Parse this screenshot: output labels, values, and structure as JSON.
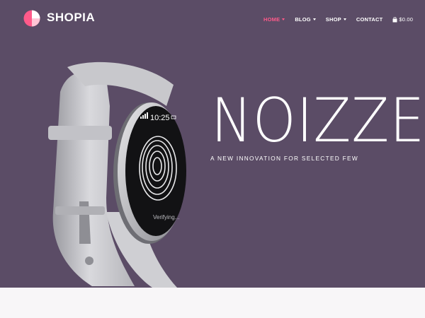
{
  "header": {
    "brand": "SHOPIA",
    "nav": [
      {
        "label": "HOME",
        "dropdown": true,
        "active": true
      },
      {
        "label": "BLOG",
        "dropdown": true,
        "active": false
      },
      {
        "label": "SHOP",
        "dropdown": true,
        "active": false
      },
      {
        "label": "CONTACT",
        "dropdown": false,
        "active": false
      }
    ],
    "cart_total": "$0.00"
  },
  "hero": {
    "title": "NOIZZE",
    "tagline": "A NEW INNOVATION FOR SELECTED FEW",
    "watch_time": "10:25",
    "watch_status": "Verifying..."
  },
  "colors": {
    "hero_bg": "#5b4c66",
    "accent": "#ff5a8a",
    "text": "#ffffff",
    "page_bg": "#f8f6f8"
  }
}
